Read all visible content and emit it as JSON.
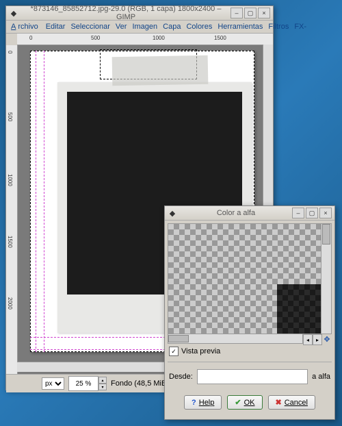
{
  "main": {
    "title": "*873146_85852712.jpg-29.0 (RGB, 1 capa) 1800x2400 – GIMP",
    "ruler_h": [
      "0",
      "500",
      "1000",
      "1500"
    ],
    "ruler_v": [
      "0",
      "500",
      "1000",
      "1500",
      "2000"
    ]
  },
  "menu": {
    "archivo": "Archivo",
    "editar": "Editar",
    "seleccionar": "Seleccionar",
    "ver": "Ver",
    "imagen": "Imagen",
    "capa": "Capa",
    "colores": "Colores",
    "herramientas": "Herramientas",
    "filtros": "Filtros",
    "fx": "FX-"
  },
  "status": {
    "unit": "px",
    "zoom": "25 %",
    "info": "Fondo (48,5 MiB)"
  },
  "dialog": {
    "title": "Color a alfa",
    "preview_label": "Vista previa",
    "from_label": "Desde:",
    "to_label": "a alfa",
    "help": "Help",
    "ok": "OK",
    "cancel": "Cancel"
  }
}
